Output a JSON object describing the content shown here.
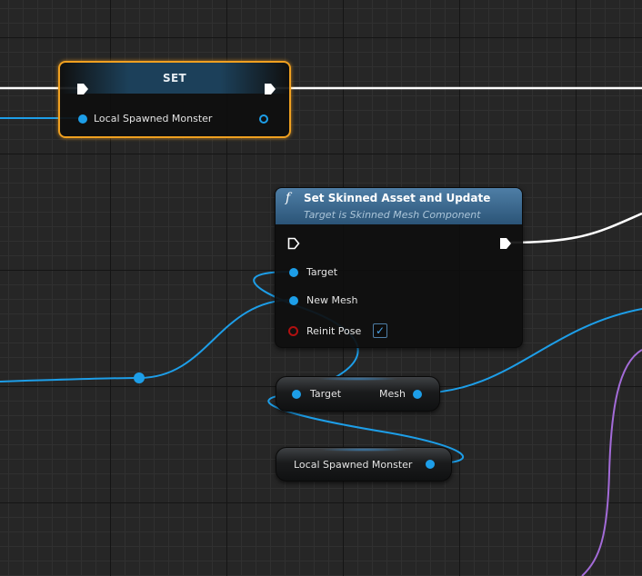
{
  "set_node": {
    "title": "SET",
    "variable_label": "Local Spawned Monster"
  },
  "function_node": {
    "icon": "f",
    "title": "Set Skinned Asset and Update",
    "subtitle": "Target is Skinned Mesh Component",
    "pins": {
      "target": "Target",
      "new_mesh": "New Mesh",
      "reinit_pose": "Reinit Pose"
    },
    "reinit_pose_checked": true
  },
  "mesh_getter_node": {
    "input_label": "Target",
    "output_label": "Mesh"
  },
  "variable_getter_node": {
    "label": "Local Spawned Monster"
  },
  "colors": {
    "object_pin": "#1d9ee8",
    "exec_wire": "#ffffff",
    "selection": "#f0a020",
    "bool_pin": "#b01010",
    "purple_wire": "#a36bd8"
  }
}
